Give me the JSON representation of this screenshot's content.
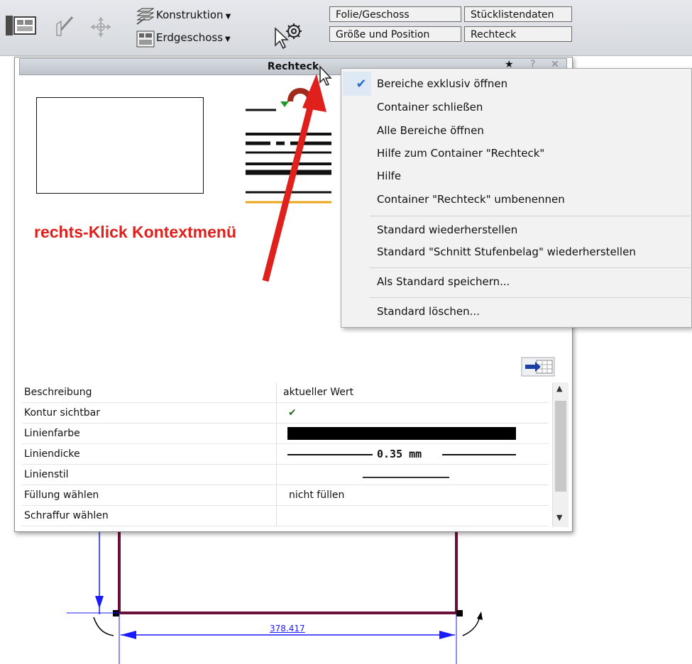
{
  "toolbar": {
    "construction_label": "Konstruktion",
    "floor_label": "Erdgeschoss",
    "buttons": {
      "folie": "Folie/Geschoss",
      "stueckliste": "Stücklistendaten",
      "groesse": "Größe und Position",
      "rechteck": "Rechteck"
    },
    "icons": [
      "floorplan-icon",
      "pencil-icon",
      "move-icon",
      "layers-icon",
      "floor-icon",
      "cursor-gear-icon"
    ]
  },
  "palette": {
    "title": "Rechteck",
    "controls": [
      "star-icon",
      "help-icon",
      "close-icon"
    ]
  },
  "annotation": "rechts-Klick Kontextmenü",
  "properties": {
    "header": {
      "col1": "Beschreibung",
      "col2": "aktueller Wert"
    },
    "rows": [
      {
        "label": "Kontur sichtbar",
        "value": "✔"
      },
      {
        "label": "Linienfarbe",
        "value": ""
      },
      {
        "label": "Liniendicke",
        "value": "0.35 mm"
      },
      {
        "label": "Linienstil",
        "value": ""
      },
      {
        "label": "Füllung wählen",
        "value": "nicht füllen"
      },
      {
        "label": "Schraffur wählen",
        "value": ""
      }
    ]
  },
  "context_menu": {
    "items": [
      {
        "label": "Bereiche exklusiv öffnen",
        "checked": true
      },
      {
        "label": "Container schließen"
      },
      {
        "label": "Alle Bereiche öffnen"
      },
      {
        "label": "Hilfe zum Container \"Rechteck\""
      },
      {
        "label": "Hilfe"
      },
      {
        "label": "Container \"Rechteck\" umbenennen"
      },
      {
        "label": "Standard wiederherstellen"
      },
      {
        "label": "Standard \"Schnitt Stufenbelag\" wiederherstellen"
      },
      {
        "label": "Als Standard speichern..."
      },
      {
        "label": "Standard löschen..."
      }
    ]
  },
  "dimension": "378.417",
  "colors": {
    "accent_red": "#e0201c",
    "dim_blue": "#1a1aff",
    "wall": "#6a0f3a",
    "check_blue": "#2a6fc9"
  }
}
